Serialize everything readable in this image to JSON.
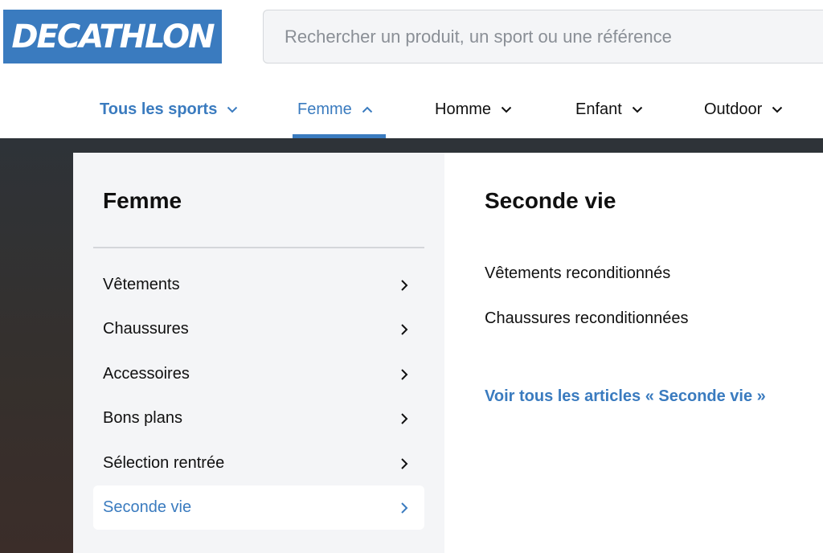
{
  "brand": {
    "logo_text": "DECATHLON",
    "color": "#3a7bbf"
  },
  "search": {
    "placeholder": "Rechercher un produit, un sport ou une référence",
    "value": ""
  },
  "nav": {
    "items": [
      {
        "label": "Tous les sports",
        "icon": "chevron-down-icon"
      },
      {
        "label": "Femme",
        "icon": "chevron-up-icon",
        "active": true
      },
      {
        "label": "Homme",
        "icon": "chevron-down-icon"
      },
      {
        "label": "Enfant",
        "icon": "chevron-down-icon"
      },
      {
        "label": "Outdoor",
        "icon": "chevron-down-icon"
      }
    ]
  },
  "menu": {
    "title": "Femme",
    "items": [
      {
        "label": "Vêtements",
        "icon": "chevron-right-icon"
      },
      {
        "label": "Chaussures",
        "icon": "chevron-right-icon"
      },
      {
        "label": "Accessoires",
        "icon": "chevron-right-icon"
      },
      {
        "label": "Bons plans",
        "icon": "chevron-right-icon"
      },
      {
        "label": "Sélection rentrée",
        "icon": "chevron-right-icon"
      },
      {
        "label": "Seconde vie",
        "icon": "chevron-right-icon",
        "active": true
      }
    ]
  },
  "submenu": {
    "title": "Seconde vie",
    "links": [
      {
        "label": "Vêtements reconditionnés"
      },
      {
        "label": "Chaussures reconditionnées"
      }
    ],
    "see_all": "Voir tous les articles « Seconde vie »"
  },
  "colors": {
    "accent": "#3a7bbf",
    "panel_bg": "#f4f5f7",
    "overlay": "#2e3338"
  }
}
